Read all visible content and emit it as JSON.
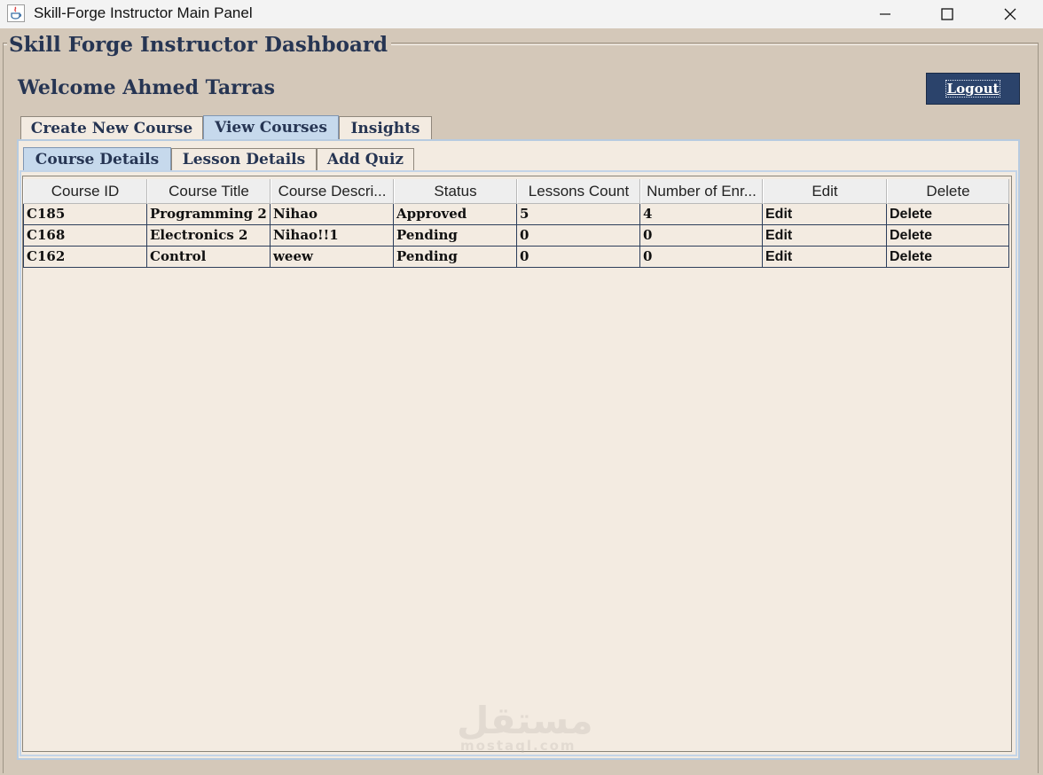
{
  "window": {
    "title": "Skill-Forge Instructor Main Panel",
    "icon": "java-coffee-icon"
  },
  "dashboard": {
    "group_title": "Skill Forge Instructor Dashboard",
    "welcome": "Welcome Ahmed Tarras",
    "logout_label": "Logout"
  },
  "outer_tabs": [
    {
      "label": "Create New Course",
      "selected": false
    },
    {
      "label": "View Courses",
      "selected": true
    },
    {
      "label": "Insights",
      "selected": false
    }
  ],
  "inner_tabs": [
    {
      "label": "Course Details",
      "selected": true
    },
    {
      "label": "Lesson Details",
      "selected": false
    },
    {
      "label": "Add Quiz",
      "selected": false
    }
  ],
  "table": {
    "columns": [
      "Course ID",
      "Course Title",
      "Course Descri...",
      "Status",
      "Lessons Count",
      "Number of Enr...",
      "Edit",
      "Delete"
    ],
    "rows": [
      [
        "C185",
        "Programming 2",
        "Nihao",
        "Approved",
        "5",
        "4",
        "Edit",
        "Delete"
      ],
      [
        "C168",
        "Electronics 2",
        "Nihao!!1",
        "Pending",
        "0",
        "0",
        "Edit",
        "Delete"
      ],
      [
        "C162",
        "Control",
        "weew",
        "Pending",
        "0",
        "0",
        "Edit",
        "Delete"
      ]
    ]
  },
  "watermark": {
    "arabic": "مستقل",
    "latin": "mostaql.com"
  },
  "colors": {
    "background": "#d4c8b9",
    "panel": "#f3ebe1",
    "accent": "#263553",
    "selected_tab": "#c6d9ec",
    "logout_button": "#2b436b"
  }
}
